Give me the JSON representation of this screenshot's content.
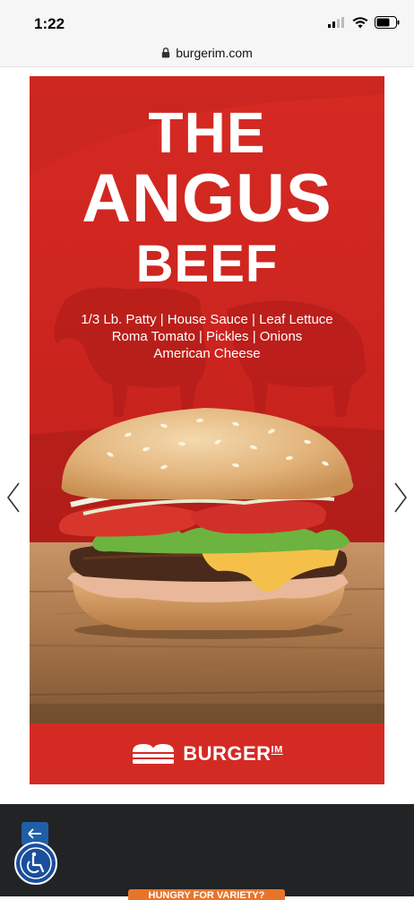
{
  "status_bar": {
    "time": "1:22"
  },
  "browser": {
    "url": "burgerim.com"
  },
  "poster": {
    "headline_line1": "THE",
    "headline_line2": "ANGUS",
    "headline_line3": "BEEF",
    "ingredients_line1": "1/3 Lb. Patty | House Sauce | Leaf Lettuce",
    "ingredients_line2": "Roma Tomato | Pickles | Onions",
    "ingredients_line3": "American Cheese",
    "brand_name": "BURGER",
    "brand_suffix": "IM"
  },
  "footer": {
    "promo_label": "HUNGRY FOR VARIETY?"
  },
  "colors": {
    "poster_red": "#cc2420",
    "footer_dark": "#222325",
    "promo_orange": "#e8742a",
    "accessibility_blue": "#1a4f9b"
  }
}
